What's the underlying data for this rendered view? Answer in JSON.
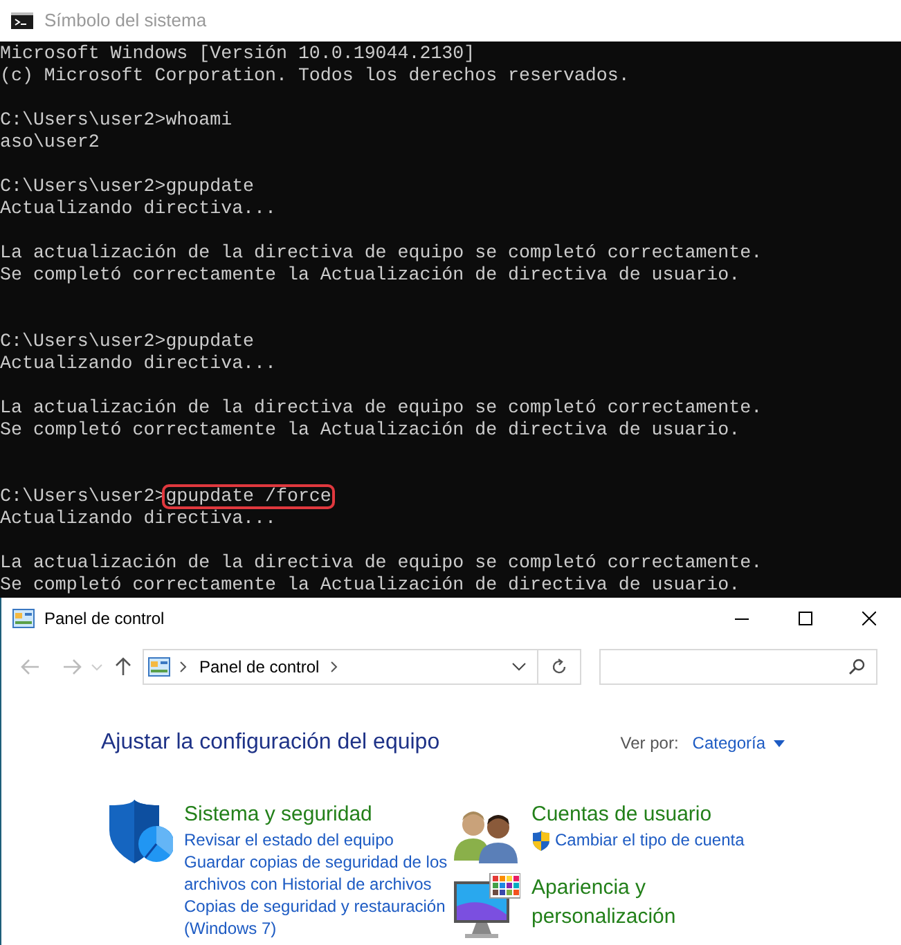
{
  "console": {
    "title": "Símbolo del sistema",
    "lines": [
      {
        "kind": "text",
        "text": "Microsoft Windows [Versión 10.0.19044.2130]"
      },
      {
        "kind": "text",
        "text": "(c) Microsoft Corporation. Todos los derechos reservados."
      },
      {
        "kind": "blank"
      },
      {
        "kind": "text",
        "text": "C:\\Users\\user2>whoami"
      },
      {
        "kind": "text",
        "text": "aso\\user2"
      },
      {
        "kind": "blank"
      },
      {
        "kind": "text",
        "text": "C:\\Users\\user2>gpupdate"
      },
      {
        "kind": "text",
        "text": "Actualizando directiva..."
      },
      {
        "kind": "blank"
      },
      {
        "kind": "text",
        "text": "La actualización de la directiva de equipo se completó correctamente."
      },
      {
        "kind": "text",
        "text": "Se completó correctamente la Actualización de directiva de usuario."
      },
      {
        "kind": "blank"
      },
      {
        "kind": "blank"
      },
      {
        "kind": "text",
        "text": "C:\\Users\\user2>gpupdate"
      },
      {
        "kind": "text",
        "text": "Actualizando directiva..."
      },
      {
        "kind": "blank"
      },
      {
        "kind": "text",
        "text": "La actualización de la directiva de equipo se completó correctamente."
      },
      {
        "kind": "text",
        "text": "Se completó correctamente la Actualización de directiva de usuario."
      },
      {
        "kind": "blank"
      },
      {
        "kind": "blank"
      },
      {
        "kind": "command",
        "prompt": "C:\\Users\\user2>",
        "command": "gpupdate /force",
        "highlighted": true
      },
      {
        "kind": "text",
        "text": "Actualizando directiva..."
      },
      {
        "kind": "blank"
      },
      {
        "kind": "text",
        "text": "La actualización de la directiva de equipo se completó correctamente."
      },
      {
        "kind": "text",
        "text": "Se completó correctamente la Actualización de directiva de usuario."
      }
    ]
  },
  "control_panel": {
    "title": "Panel de control",
    "address": "Panel de control",
    "heading": "Ajustar la configuración del equipo",
    "view_by_label": "Ver por:",
    "view_by_value": "Categoría",
    "categories": [
      {
        "title": "Sistema y seguridad",
        "links": [
          {
            "text": "Revisar el estado del equipo"
          },
          {
            "text": "Guardar copias de seguridad de los archivos con Historial de archivos"
          },
          {
            "text": "Copias de seguridad y restauración (Windows 7)"
          }
        ]
      },
      {
        "title": "Cuentas de usuario",
        "links": [
          {
            "text": "Cambiar el tipo de cuenta",
            "shield": true
          }
        ]
      },
      {
        "title": "Apariencia y personalización"
      }
    ]
  }
}
